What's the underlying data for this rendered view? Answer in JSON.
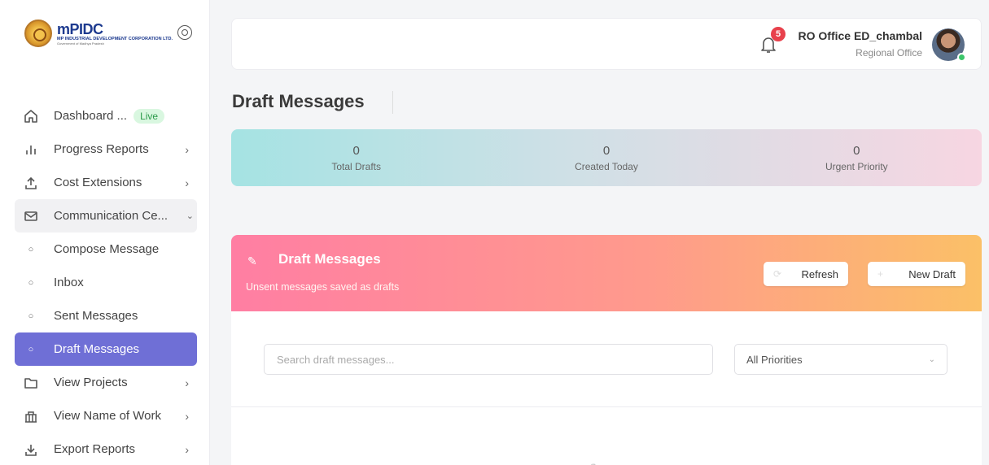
{
  "brand": {
    "logo_mark": "mPIDC",
    "logo_sub": "MP INDUSTRIAL DEVELOPMENT CORPORATION LTD.",
    "logo_gov": "Government of Madhya Pradesh"
  },
  "sidebar": {
    "items": [
      {
        "label": "Dashboard ...",
        "badge": "Live",
        "icon": "home-icon"
      },
      {
        "label": "Progress Reports",
        "icon": "bar-chart-icon"
      },
      {
        "label": "Cost Extensions",
        "icon": "upload-icon"
      },
      {
        "label": "Communication Ce...",
        "icon": "mail-icon"
      },
      {
        "label": "Compose Message",
        "icon": "circle-icon"
      },
      {
        "label": "Inbox",
        "icon": "circle-icon"
      },
      {
        "label": "Sent Messages",
        "icon": "circle-icon"
      },
      {
        "label": "Draft Messages",
        "icon": "circle-icon"
      },
      {
        "label": "View Projects",
        "icon": "folder-icon"
      },
      {
        "label": "View Name of Work",
        "icon": "building-icon"
      },
      {
        "label": "Export Reports",
        "icon": "download-icon"
      }
    ]
  },
  "header": {
    "notification_count": "5",
    "user_name": "RO Office ED_chambal",
    "user_role": "Regional Office"
  },
  "page": {
    "title": "Draft Messages"
  },
  "stats": [
    {
      "value": "0",
      "label": "Total Drafts"
    },
    {
      "value": "0",
      "label": "Created Today"
    },
    {
      "value": "0",
      "label": "Urgent Priority"
    }
  ],
  "card": {
    "title": "Draft Messages",
    "subtitle": "Unsent messages saved as drafts",
    "refresh_label": "Refresh",
    "new_draft_label": "New Draft",
    "search_placeholder": "Search draft messages...",
    "priority_selected": "All Priorities"
  },
  "colors": {
    "accent": "#6f6fd6",
    "live_badge": "#2b9a4a",
    "notification": "#e8414c"
  }
}
